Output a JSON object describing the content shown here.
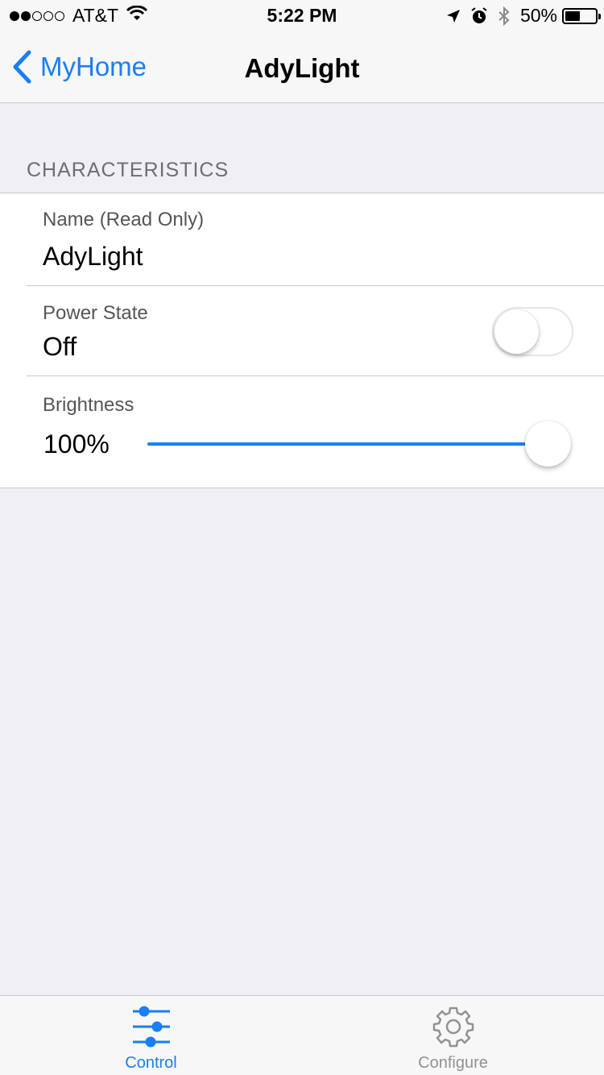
{
  "status_bar": {
    "carrier": "AT&T",
    "time": "5:22 PM",
    "battery_percent": "50%",
    "battery_level": 0.5,
    "signal_bars_filled": 2,
    "signal_bars_total": 5,
    "icons": [
      "wifi-icon",
      "location-arrow-icon",
      "alarm-icon",
      "bluetooth-icon",
      "battery-icon"
    ]
  },
  "nav": {
    "back_label": "MyHome",
    "title": "AdyLight"
  },
  "section": {
    "header": "CHARACTERISTICS"
  },
  "characteristics": {
    "name": {
      "label": "Name (Read Only)",
      "value": "AdyLight"
    },
    "power": {
      "label": "Power State",
      "value": "Off",
      "is_on": false
    },
    "brightness": {
      "label": "Brightness",
      "value": "100%",
      "level": 1.0
    }
  },
  "tabs": [
    {
      "label": "Control",
      "icon": "sliders-icon",
      "active": true
    },
    {
      "label": "Configure",
      "icon": "gear-icon",
      "active": false
    }
  ],
  "colors": {
    "accent": "#1a7ef5",
    "background": "#efeff4",
    "inactive_tab": "#929292"
  }
}
